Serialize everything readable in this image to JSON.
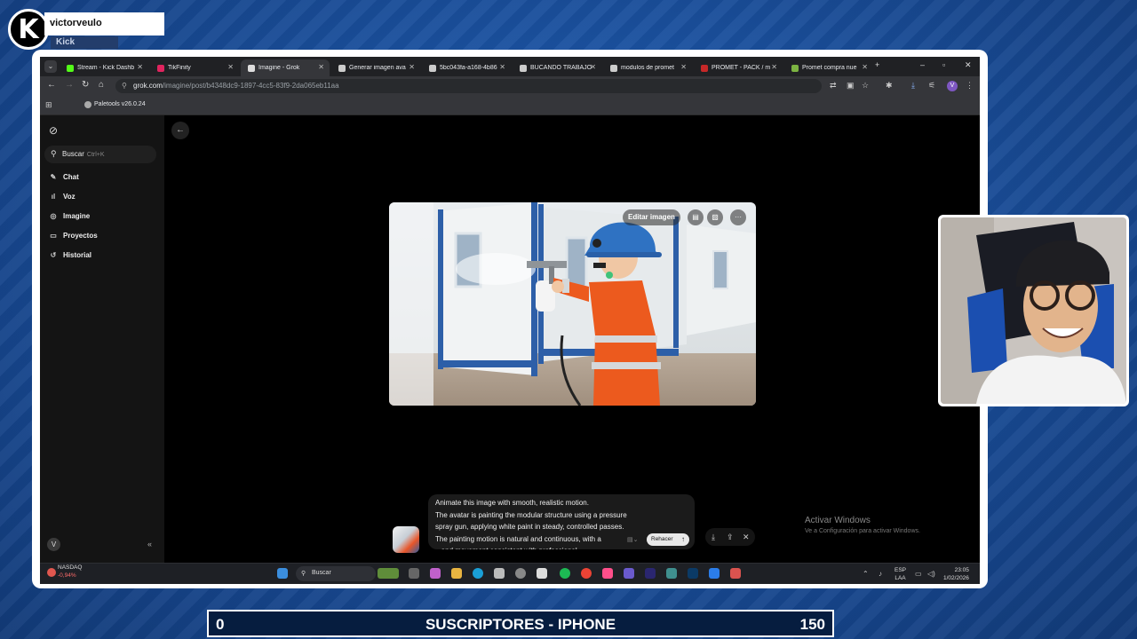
{
  "overlay": {
    "username": "victorveulo",
    "platform": "Kick",
    "goal": {
      "start": "0",
      "title": "SUSCRIPTORES - IPHONE",
      "end": "150"
    }
  },
  "browser": {
    "tabs": [
      {
        "title": "Stream - Kick Dashb",
        "color": "#53fc18"
      },
      {
        "title": "TikFinity",
        "color": "#e0245e"
      },
      {
        "title": "Imagine - Grok",
        "color": "#dddddd",
        "active": true
      },
      {
        "title": "Generar imagen ava",
        "color": "#cccccc"
      },
      {
        "title": "5bc043fa-a168-4b86",
        "color": "#cccccc"
      },
      {
        "title": "BUCANDO TRABAJO",
        "color": "#cccccc"
      },
      {
        "title": "modulos de promet",
        "color": "#cccccc"
      },
      {
        "title": "PROMET - PACK / m",
        "color": "#c62828"
      },
      {
        "title": "Promet compra nue",
        "color": "#7cb342"
      }
    ],
    "url_host": "grok.com",
    "url_path": "/imagine/post/b4348dc9-1897-4cc5-83f9-2da065eb11aa",
    "bookmark": "Paletools v26.0.24",
    "profile_initial": "V"
  },
  "grok": {
    "search_label": "Buscar",
    "search_shortcut": "Ctrl+K",
    "nav": [
      {
        "label": "Chat",
        "icon": "chat-icon",
        "glyph": "✎"
      },
      {
        "label": "Voz",
        "icon": "voice-icon",
        "glyph": "ıl"
      },
      {
        "label": "Imagine",
        "icon": "imagine-icon",
        "glyph": "◎"
      },
      {
        "label": "Proyectos",
        "icon": "projects-icon",
        "glyph": "▭"
      },
      {
        "label": "Historial",
        "icon": "history-icon",
        "glyph": "↺"
      }
    ],
    "user_initial": "V",
    "edit_image_label": "Editar imagen",
    "prompt_lines": [
      "Animate this image with smooth, realistic motion.",
      "The avatar is painting the modular structure using a pressure",
      "spray gun, applying white paint in steady, controlled passes.",
      "The painting motion is natural and continuous, with a",
      "...and movement consistent with professional"
    ],
    "redo_label": "Rehacer"
  },
  "windows": {
    "activate_title": "Activar Windows",
    "activate_sub": "Ve a Configuración para activar Windows.",
    "search_label": "Buscar",
    "ticker_name": "NASDAQ",
    "ticker_change": "-0,94%",
    "lang_top": "ESP",
    "lang_bottom": "LAA",
    "time": "23:05",
    "date": "1/02/2026"
  }
}
